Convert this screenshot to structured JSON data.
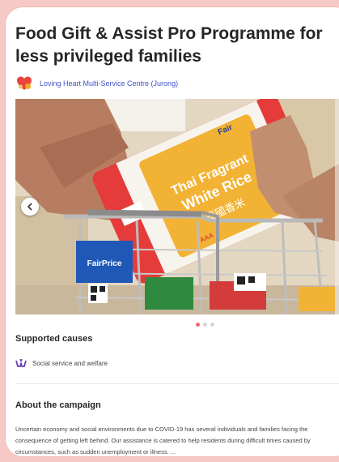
{
  "campaign": {
    "title": "Food Gift & Assist Pro Programme for less privileged families",
    "organizer": "Loving Heart Multi-Service Centre (Jurong)",
    "photo_text": {
      "bag_line1": "Thai Fragrant",
      "bag_line2": "White Rice",
      "bag_chinese": "泰國香米",
      "bag_brand": "Fair",
      "bag_grade": "AAA",
      "basket_brand": "FairPrice"
    },
    "carousel": {
      "prev_icon": "chevron-left-icon",
      "active_index": 0,
      "count": 3
    }
  },
  "supported_causes": {
    "heading": "Supported causes",
    "items": [
      {
        "icon": "hands-heart-icon",
        "label": "Social service and welfare"
      }
    ]
  },
  "about": {
    "heading": "About the campaign",
    "text": "Uncertain economy and social environments due to COVID-19 has several individuals and families facing the consequence of getting left behind. Our assistance is catered to help residents during difficult times caused by circumstances, such as sudden unemployment or illness. ..."
  },
  "colors": {
    "background": "#f6c9c4",
    "link": "#3f52c9",
    "dot_active": "#ef6a6a",
    "cause_icon": "#6a3fb5"
  }
}
